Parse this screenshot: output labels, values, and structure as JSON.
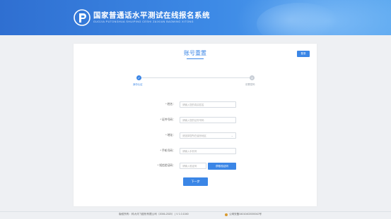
{
  "header": {
    "title": "国家普通话水平测试在线报名系统",
    "subtitle": "GUOJIA PUTONGHUA SHUIPING CESHI ZAIXIAN BAOMING XITONG",
    "logo_icon": "putonghua-logo-icon",
    "colors": {
      "gradient_start": "#2f6fd1",
      "gradient_end": "#5aa7ef"
    }
  },
  "card": {
    "title": "账号重置",
    "login_button": "登录"
  },
  "steps": [
    {
      "label": "身份认证",
      "state": "active",
      "icon": "check-icon"
    },
    {
      "label": "设置密码",
      "state": "pending",
      "number": "2"
    }
  ],
  "form": {
    "name": {
      "label": "* 姓名：",
      "placeholder": "请输入您的真实姓名"
    },
    "id_number": {
      "label": "* 证件号码：",
      "placeholder": "请输入您的证件号码"
    },
    "region": {
      "label": "* 地址：",
      "placeholder": "请选择您所在省份地区"
    },
    "phone": {
      "label": "* 手机号码：",
      "placeholder": "请输入手机号"
    },
    "sms_code": {
      "label": "* 短信验证码：",
      "placeholder": "请输入验证码",
      "button": "获取验证码"
    },
    "next_button": "下一步"
  },
  "footer": {
    "copyright": "版权所有：科大讯飞股份有限公司（2006-2020） | V 1.0.1040",
    "icp": "公网安备34010402000042号"
  },
  "accent_color": "#3b86e6"
}
